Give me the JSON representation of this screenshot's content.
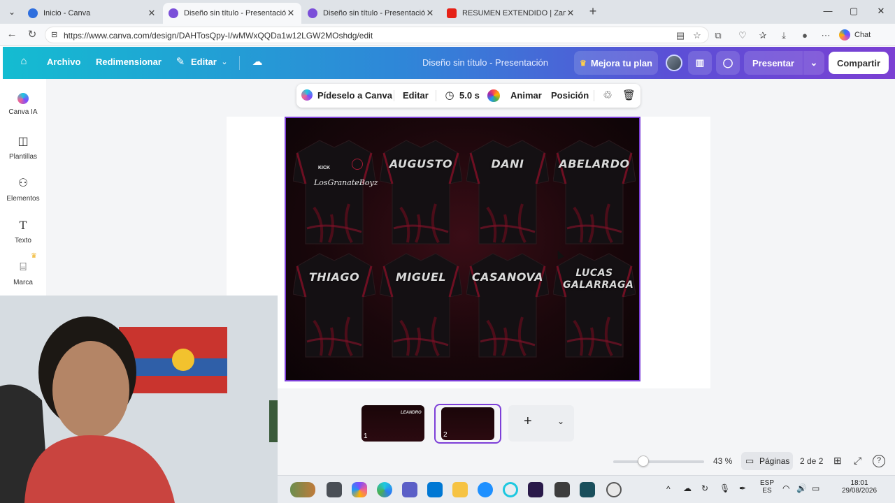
{
  "browser": {
    "tabs": [
      {
        "title": "Inicio - Canva",
        "active": false,
        "favicon_color": "#2f6fde"
      },
      {
        "title": "Diseño sin título - Presentación",
        "active": true,
        "favicon_color": "#7b4fd9"
      },
      {
        "title": "Diseño sin título - Presentación",
        "active": false,
        "favicon_color": "#7b4fd9"
      },
      {
        "title": "RESUMEN EXTENDIDO | Zamora",
        "active": false,
        "favicon_color": "#e62117"
      }
    ],
    "url": "https://www.canva.com/design/DAHTosQpy-I/wMWxQQDa1w12LGW2MOshdg/edit",
    "chat_label": "Chat"
  },
  "canva_bar": {
    "archivo": "Archivo",
    "redimensionar": "Redimensionar",
    "editar": "Editar",
    "doc_title": "Diseño sin título - Presentación",
    "upgrade": "Mejora tu plan",
    "present": "Presentar",
    "share": "Compartir"
  },
  "sidebar": {
    "items": [
      {
        "label": "Canva IA",
        "icon": "canva-ai-icon"
      },
      {
        "label": "Plantillas",
        "icon": "templates-icon"
      },
      {
        "label": "Elementos",
        "icon": "elements-icon"
      },
      {
        "label": "Texto",
        "icon": "text-icon"
      },
      {
        "label": "Marca",
        "icon": "brand-icon"
      }
    ]
  },
  "toolbar": {
    "ask_canva": "Pídeselo a Canva",
    "edit": "Editar",
    "duration": "5.0 s",
    "animate": "Animar",
    "position": "Posición"
  },
  "slide": {
    "jerseys": [
      {
        "name": "",
        "front": true,
        "team": "LosGranateBoyz",
        "sponsor": "KICK"
      },
      {
        "name": "AUGUSTO"
      },
      {
        "name": "DANI"
      },
      {
        "name": "ABELARDO"
      },
      {
        "name": "THIAGO"
      },
      {
        "name": "MIGUEL"
      },
      {
        "name": "CASANOVA"
      },
      {
        "name": "LUCAS GALARRAGA"
      }
    ]
  },
  "pages": {
    "thumbs": [
      {
        "number": "1",
        "preview_name": "LEANDRO"
      },
      {
        "number": "2"
      }
    ]
  },
  "status": {
    "zoom": "43 %",
    "zoom_fraction": 0.33,
    "pages_label": "Páginas",
    "page_count": "2 de 2"
  },
  "taskbar": {
    "lang_top": "ESP",
    "lang_bottom": "ES",
    "time": "18:01",
    "date": "29/08/2026"
  }
}
